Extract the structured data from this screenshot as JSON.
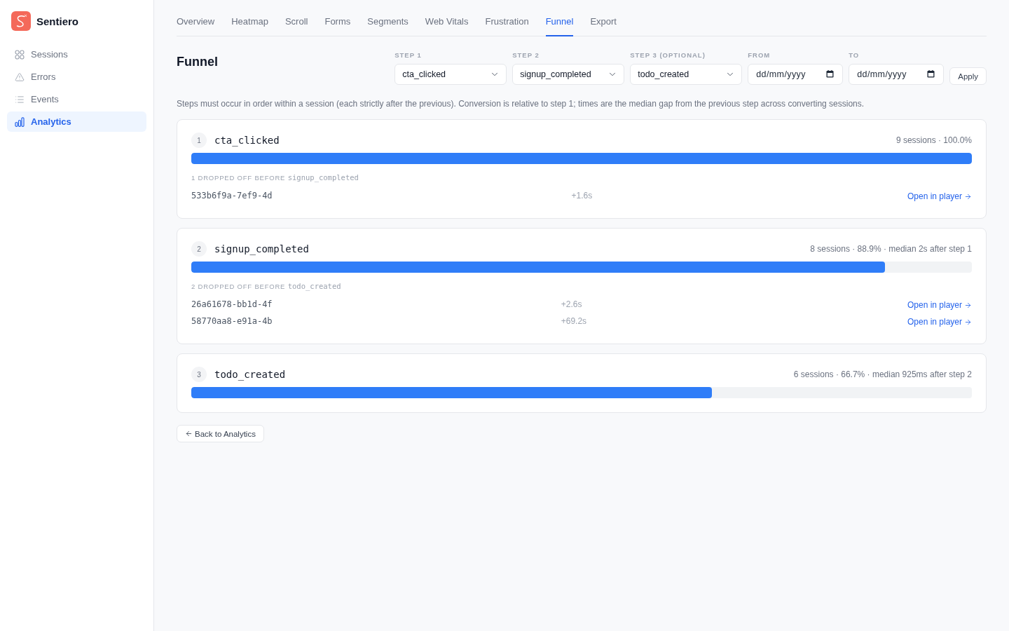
{
  "app": {
    "name": "Sentiero"
  },
  "sidebar": {
    "items": [
      {
        "label": "Sessions",
        "selected": false
      },
      {
        "label": "Errors",
        "selected": false
      },
      {
        "label": "Events",
        "selected": false
      },
      {
        "label": "Analytics",
        "selected": true
      }
    ]
  },
  "tabs": [
    {
      "label": "Overview",
      "selected": false
    },
    {
      "label": "Heatmap",
      "selected": false
    },
    {
      "label": "Scroll",
      "selected": false
    },
    {
      "label": "Forms",
      "selected": false
    },
    {
      "label": "Segments",
      "selected": false
    },
    {
      "label": "Web Vitals",
      "selected": false
    },
    {
      "label": "Frustration",
      "selected": false
    },
    {
      "label": "Funnel",
      "selected": true
    },
    {
      "label": "Export",
      "selected": false
    }
  ],
  "page": {
    "title": "Funnel"
  },
  "filters": [
    {
      "kind": "select",
      "label": "STEP 1",
      "value": "cta_clicked"
    },
    {
      "kind": "select",
      "label": "STEP 2",
      "value": "signup_completed"
    },
    {
      "kind": "select",
      "label": "STEP 3 (OPTIONAL)",
      "value": "todo_created"
    },
    {
      "kind": "date",
      "label": "FROM",
      "placeholder": "dd/mm/yyyy"
    },
    {
      "kind": "date",
      "label": "TO",
      "placeholder": "dd/mm/yyyy"
    }
  ],
  "apply_button": {
    "label": "Apply"
  },
  "description": "Steps must occur in order within a session (each strictly after the previous). Conversion is relative to step 1; times are the median gap from the previous step across converting sessions.",
  "steps": [
    {
      "number": "1",
      "event": "cta_clicked",
      "summary": "9 sessions · 100.0%",
      "level": 1.0,
      "dropped_off": {
        "label": "1 DROPPED OFF BEFORE",
        "event": "signup_completed"
      },
      "sessions": [
        {
          "id": "533b6f9a-7ef9-4d",
          "gap": "+1.6s",
          "link": "Open in player"
        }
      ]
    },
    {
      "number": "2",
      "event": "signup_completed",
      "summary": "8 sessions · 88.9% · median 2s after step 1",
      "level": 0.889,
      "dropped_off": {
        "label": "2 DROPPED OFF BEFORE",
        "event": "todo_created"
      },
      "sessions": [
        {
          "id": "26a61678-bb1d-4f",
          "gap": "+2.6s",
          "link": "Open in player"
        },
        {
          "id": "58770aa8-e91a-4b",
          "gap": "+69.2s",
          "link": "Open in player"
        }
      ]
    },
    {
      "number": "3",
      "event": "todo_created",
      "summary": "6 sessions · 66.7% · median 925ms after step 2",
      "level": 0.667
    }
  ],
  "back_button": {
    "label": "Back to Analytics"
  }
}
